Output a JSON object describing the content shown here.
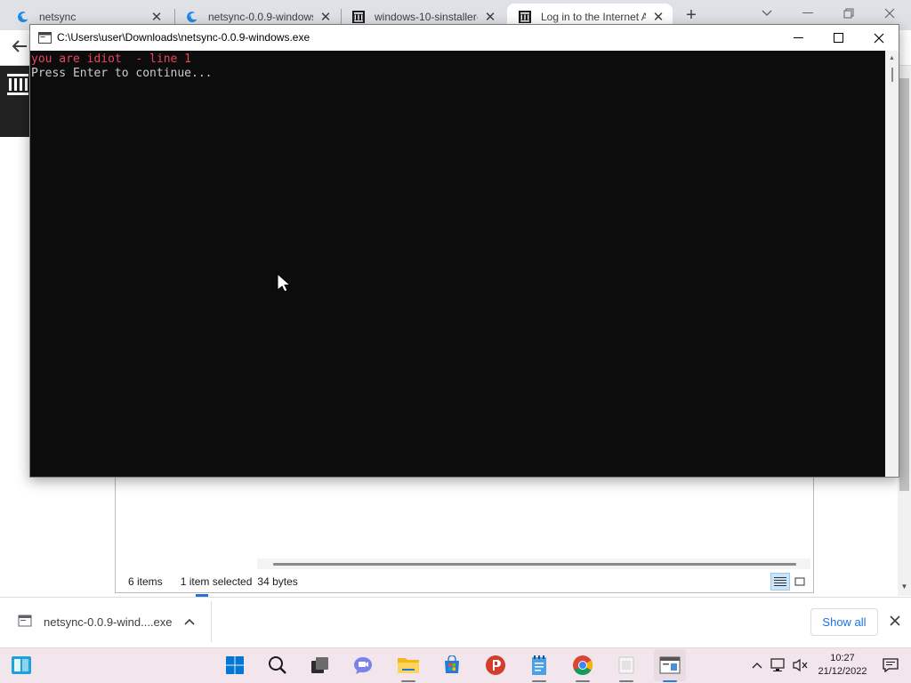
{
  "browser": {
    "tabs": [
      {
        "title": "netsync",
        "favicon": "edge-blue-icon"
      },
      {
        "title": "netsync-0.0.9-windows",
        "favicon": "edge-blue-icon"
      },
      {
        "title": "windows-10-sinstaller-",
        "favicon": "archive-org-icon"
      },
      {
        "title": "Log in to the Internet A",
        "favicon": "archive-org-icon",
        "active": true
      }
    ],
    "new_tab_label": "+"
  },
  "console": {
    "title": "C:\\Users\\user\\Downloads\\netsync-0.0.9-windows.exe",
    "lines": [
      {
        "text": "you are idiot  - line 1",
        "color": "#e74856"
      },
      {
        "text": "Press Enter to continue...",
        "color": "#cccccc"
      }
    ]
  },
  "explorer": {
    "item_count": "6 items",
    "selected": "1 item selected",
    "size": "34 bytes"
  },
  "downloads": {
    "filename": "netsync-0.0.9-wind....exe",
    "show_all": "Show all"
  },
  "taskbar": {
    "apps": [
      "start-icon",
      "search-icon",
      "task-view-icon",
      "teams-chat-icon",
      "file-explorer-icon",
      "store-icon",
      "psiphon-icon",
      "notepad-icon",
      "chrome-icon",
      "blank-app-icon",
      "console-app-icon"
    ],
    "clock": {
      "time": "10:27",
      "date": "21/12/2022"
    }
  },
  "colors": {
    "console_bg": "#0c0c0c",
    "console_error_text": "#e74856",
    "console_text": "#cccccc",
    "taskbar_bg": "#f2e6ec",
    "accent": "#1a73e8"
  }
}
